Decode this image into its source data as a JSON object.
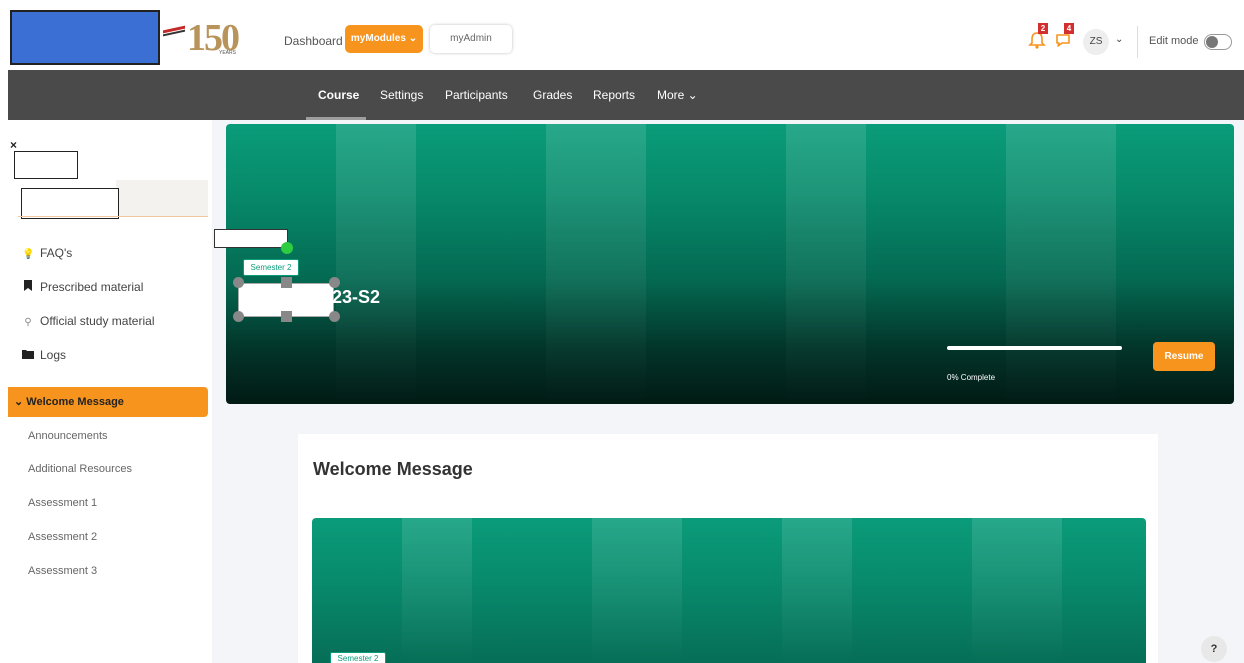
{
  "header": {
    "nav": {
      "dashboard": "Dashboard",
      "my_modules": "myModules ⌄",
      "my_admin": "myAdmin"
    },
    "logo_text": "150",
    "logo_subtext": "YEARS",
    "notifications_count": "2",
    "messages_count": "4",
    "user_initials": "ZS",
    "user_menu_caret": "⌄",
    "edit_mode_label": "Edit mode",
    "edit_mode_on": false
  },
  "course_nav": {
    "tabs": [
      "Course",
      "Settings",
      "Participants",
      "Grades",
      "Reports",
      "More ⌄"
    ],
    "active_tab": "Course"
  },
  "sidebar": {
    "close_symbol": "×",
    "items": [
      {
        "label": "FAQ's",
        "icon": "lightbulb-icon"
      },
      {
        "label": "Prescribed material",
        "icon": "bookmark-icon"
      },
      {
        "label": "Official study material",
        "icon": "graduation-icon"
      },
      {
        "label": "Logs",
        "icon": "folder-icon"
      }
    ],
    "section": {
      "label": "Welcome Message",
      "caret": "⌄"
    },
    "sub_items": [
      "Announcements",
      "Additional Resources",
      "Assessment 1",
      "Assessment 2",
      "Assessment 3"
    ]
  },
  "hero": {
    "semester_badge": "Semester 2",
    "course_code": "23-S2",
    "progress_percent": 0,
    "progress_label": "0% Complete",
    "resume_label": "Resume"
  },
  "welcome_card": {
    "title": "Welcome Message",
    "semester_badge": "Semester 2"
  },
  "help_label": "?",
  "colors": {
    "accent_orange": "#f7941d",
    "brand_green": "#0a9c7a",
    "nav_dark": "#4a4a4a"
  }
}
